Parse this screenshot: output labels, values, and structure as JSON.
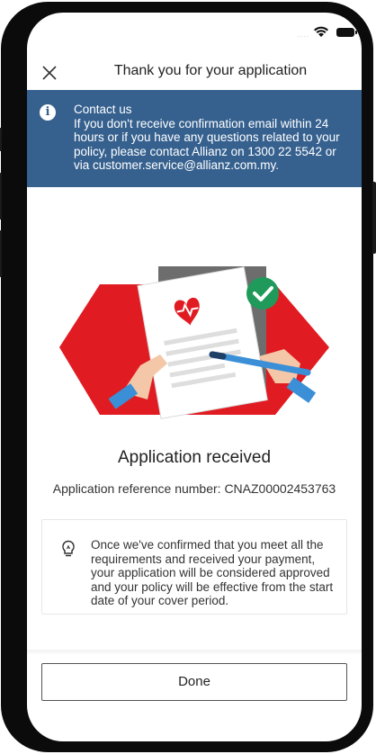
{
  "header": {
    "title": "Thank you for your application",
    "close_icon": "close-icon"
  },
  "status_bar": {
    "signal": "....",
    "icons": [
      "wifi-icon",
      "battery-icon"
    ]
  },
  "banner": {
    "icon": "info-icon",
    "title": "Contact us",
    "body": "If you don't receive confirmation email within 24 hours or if you have any questions related to your policy, please contact Allianz on 1300 22 5542 or via customer.service@allianz.com.my."
  },
  "illustration": {
    "icons": [
      "heart-pulse-icon",
      "check-badge-icon",
      "pen-icon"
    ],
    "colors": {
      "red": "#e11b22",
      "green": "#1f9a5a",
      "blue": "#3a8fd6"
    }
  },
  "main": {
    "status_title": "Application received",
    "reference_line": "Application reference number: CNAZ00002453763"
  },
  "note": {
    "icon": "lightbulb-icon",
    "text": "Once we've confirmed that you meet all the requirements and received your payment, your application will be considered approved and your policy will be effective from the start date of your cover period."
  },
  "footer": {
    "done_label": "Done"
  },
  "colors": {
    "banner_bg": "#36618f",
    "text": "#222222"
  }
}
